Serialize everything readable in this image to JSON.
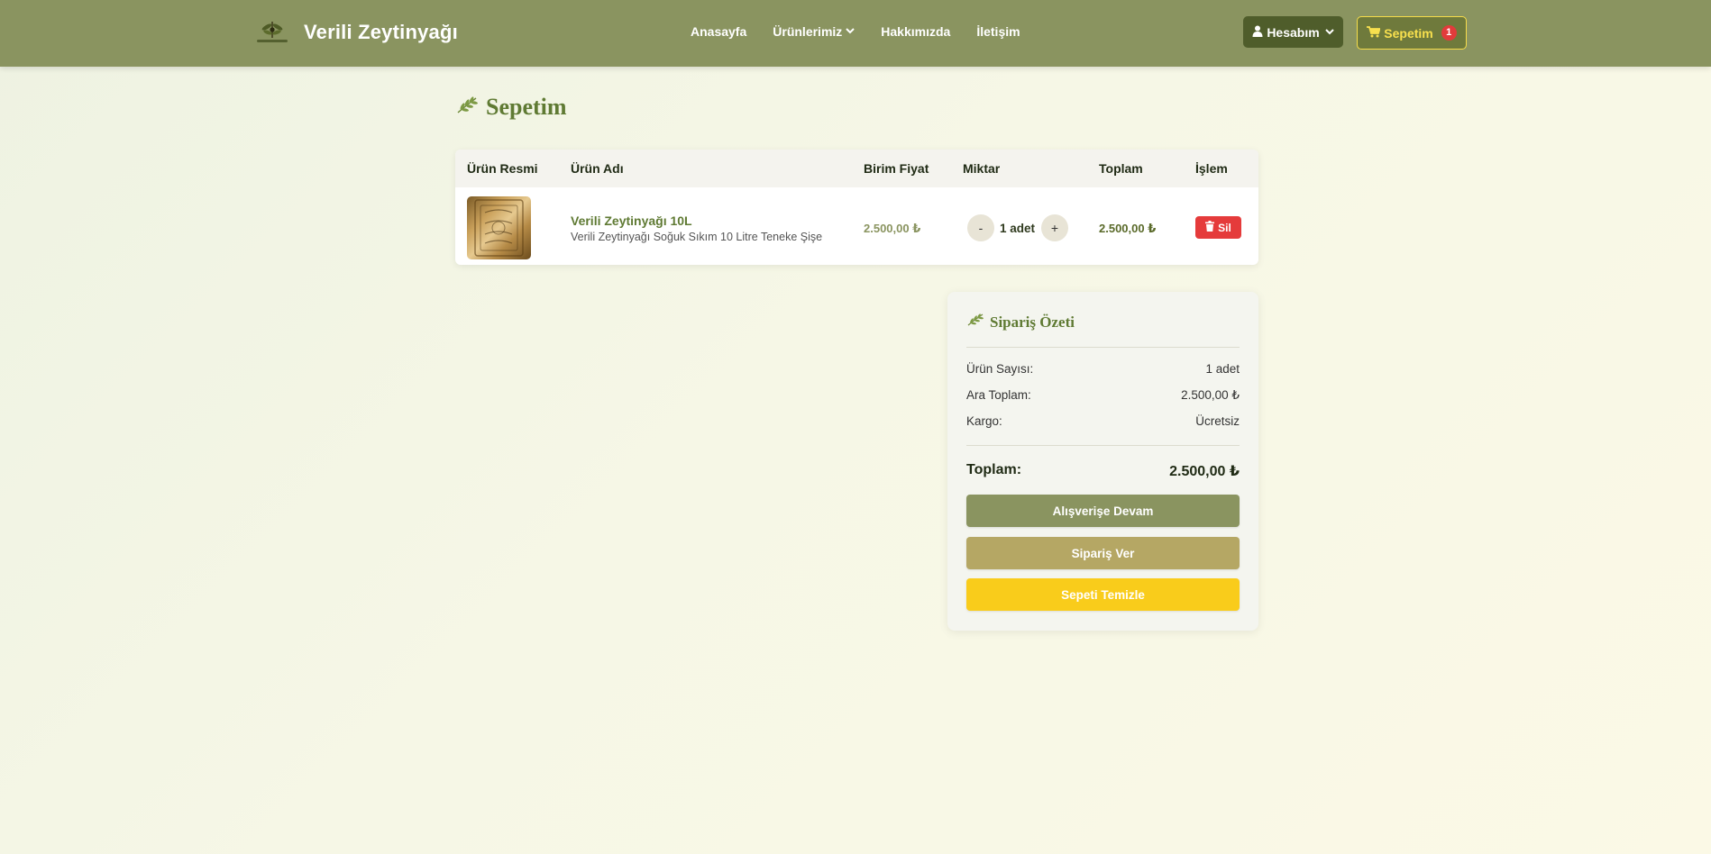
{
  "header": {
    "brand_name": "Verili Zeytinyağı",
    "nav": [
      "Anasayfa",
      "Ürünlerimiz",
      "Hakkımızda",
      "İletişim"
    ],
    "account_label": "Hesabım",
    "cart_label": "Sepetim",
    "cart_count": "1"
  },
  "page": {
    "title": "Sepetim"
  },
  "cart": {
    "columns": [
      "Ürün Resmi",
      "Ürün Adı",
      "Birim Fiyat",
      "Miktar",
      "Toplam",
      "İşlem"
    ],
    "items": [
      {
        "name": "Verili Zeytinyağı 10L",
        "description": "Verili Zeytinyağı Soğuk Sıkım 10 Litre Teneke Şişe",
        "unit_price": "2.500,00 ₺",
        "minus": "-",
        "quantity": "1 adet",
        "plus": "+",
        "total": "2.500,00 ₺",
        "delete_label": "Sil"
      }
    ]
  },
  "summary": {
    "title": "Sipariş Özeti",
    "item_count_label": "Ürün Sayısı:",
    "item_count_value": "1 adet",
    "subtotal_label": "Ara Toplam:",
    "subtotal_value": "2.500,00 ₺",
    "shipping_label": "Kargo:",
    "shipping_value": "Ücretsiz",
    "total_label": "Toplam:",
    "total_value": "2.500,00 ₺",
    "continue_label": "Alışverişe Devam",
    "order_label": "Sipariş Ver",
    "clear_label": "Sepeti Temizle"
  },
  "colors": {
    "navbar": "#8a9460",
    "accent_green": "#5f7a33",
    "account_button": "#4f5d2b",
    "delete_button": "#e53b3b",
    "continue_button": "#8a9460",
    "order_button": "#b5a764",
    "clear_button": "#f9cc1b"
  }
}
